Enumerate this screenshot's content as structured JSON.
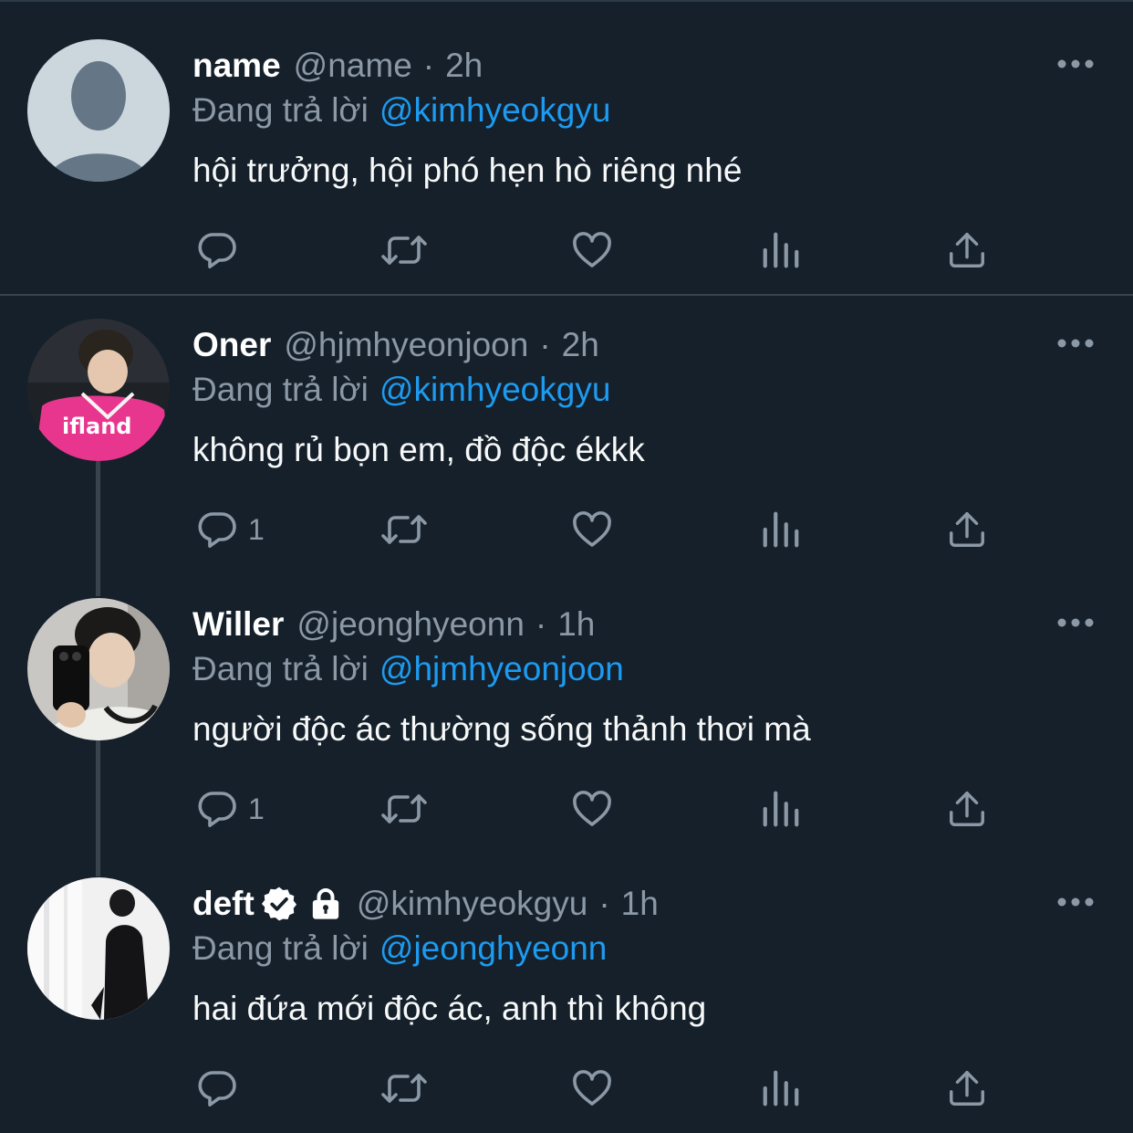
{
  "colors": {
    "background": "#15202b",
    "text": "#ffffff",
    "muted": "#8b98a5",
    "accent": "#1d9bf0",
    "divider": "#38444d"
  },
  "icons": {
    "more": "more-icon",
    "reply": "reply-icon",
    "retweet": "retweet-icon",
    "like": "like-icon",
    "views": "views-icon",
    "share": "share-icon",
    "verified": "verified-icon",
    "lock": "lock-icon"
  },
  "tweets": [
    {
      "display_name": "name",
      "handle": "@name",
      "dot": "·",
      "time": "2h",
      "reply_label": "Đang trả lời",
      "reply_mention": "@kimhyeokgyu",
      "text": "hội trưởng, hội phó hẹn hò riêng nhé",
      "reply_count": ""
    },
    {
      "display_name": "Oner",
      "handle": "@hjmhyeonjoon",
      "dot": "·",
      "time": "2h",
      "reply_label": "Đang trả lời",
      "reply_mention": "@kimhyeokgyu",
      "text": "không rủ bọn em, đồ độc ékkk",
      "reply_count": "1",
      "jersey_text": "ifland"
    },
    {
      "display_name": "Willer",
      "handle": "@jeonghyeonn",
      "dot": "·",
      "time": "1h",
      "reply_label": "Đang trả lời",
      "reply_mention": "@hjmhyeonjoon",
      "text": "người độc ác thường sống thảnh thơi mà",
      "reply_count": "1"
    },
    {
      "display_name": "deft",
      "handle": "@kimhyeokgyu",
      "dot": "·",
      "time": "1h",
      "reply_label": "Đang trả lời",
      "reply_mention": "@jeonghyeonn",
      "text": "hai đứa mới độc ác, anh thì không",
      "reply_count": ""
    }
  ]
}
